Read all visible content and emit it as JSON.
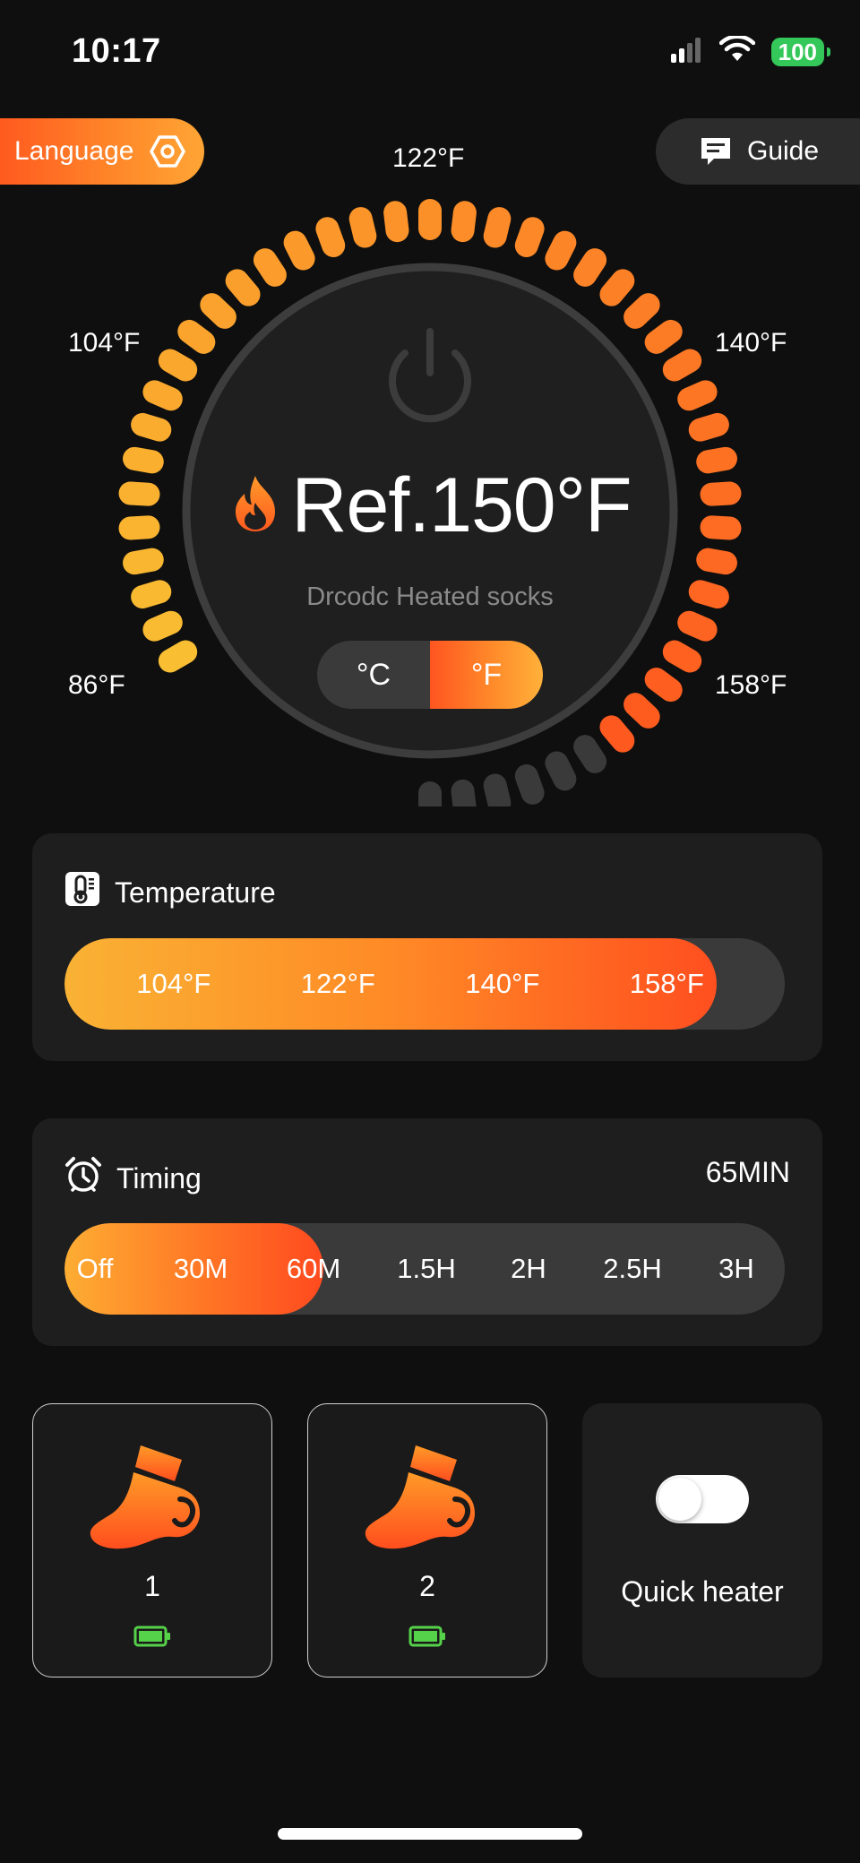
{
  "status_bar": {
    "time": "10:17",
    "battery": "100"
  },
  "header": {
    "language_label": "Language",
    "guide_label": "Guide"
  },
  "dial": {
    "labels": {
      "top": "122°F",
      "upper_left": "104°F",
      "upper_right": "140°F",
      "lower_left": "86°F",
      "lower_right": "158°F"
    },
    "set_temperature": "Ref.150°F",
    "device_name": "Drcodc Heated socks",
    "level_fraction": 0.87,
    "active_color_start": "#f9be32",
    "active_color_end": "#ff4a1c",
    "inactive_color": "#3a3a3a",
    "units": [
      "°C",
      "°F"
    ],
    "selected_unit": "°F"
  },
  "temperature_card": {
    "title": "Temperature",
    "levels": [
      "104°F",
      "122°F",
      "140°F",
      "158°F"
    ],
    "fill_fraction": 0.905
  },
  "timing_card": {
    "title": "Timing",
    "value": "65MIN",
    "options": [
      "Off",
      "30M",
      "60M",
      "1.5H",
      "2H",
      "2.5H",
      "3H"
    ],
    "fill_fraction": 0.36
  },
  "devices": [
    {
      "label": "1",
      "battery_color": "#55d24a"
    },
    {
      "label": "2",
      "battery_color": "#55d24a"
    }
  ],
  "quick_heater": {
    "label": "Quick heater",
    "enabled": false
  },
  "icons": [
    "signal-icon",
    "wifi-icon",
    "battery-icon",
    "settings-hex-icon",
    "chat-bubble-icon",
    "power-icon",
    "flame-icon",
    "thermometer-icon",
    "alarm-clock-icon",
    "sock-icon"
  ]
}
